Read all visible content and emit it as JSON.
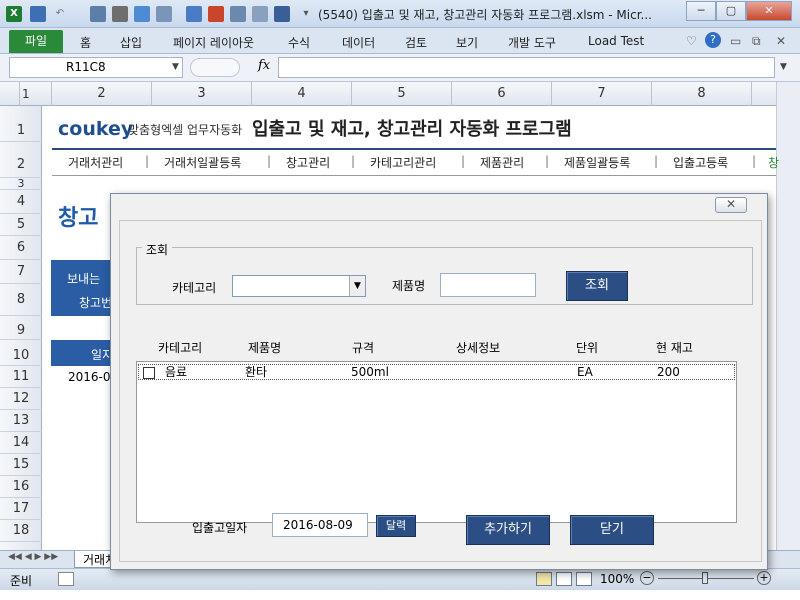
{
  "window": {
    "title": "(5540) 입출고 및 재고, 창고관리 자동화 프로그램.xlsm  -  Micr...",
    "min": "─",
    "max": "▢",
    "close": "✕"
  },
  "ribbon": {
    "file": "파일",
    "tabs": [
      "홈",
      "삽입",
      "페이지 레이아웃",
      "수식",
      "데이터",
      "검토",
      "보기",
      "개발 도구",
      "Load Test"
    ]
  },
  "formula_bar": {
    "name_box": "R11C8",
    "fx": "fx"
  },
  "columns": [
    "1",
    "2",
    "3",
    "4",
    "5",
    "6",
    "7",
    "8"
  ],
  "rows": [
    "1",
    "2",
    "3",
    "4",
    "5",
    "6",
    "7",
    "8",
    "9",
    "10",
    "11",
    "12",
    "13",
    "14",
    "15",
    "16",
    "17",
    "18"
  ],
  "sheet": {
    "brand": "coukey",
    "brand_sub": "맞춤형엑셀 업무자동화",
    "app_title": "입출고 및 재고, 창고관리 자동화 프로그램",
    "menu": [
      "거래처관리",
      "거래처일괄등록",
      "창고관리",
      "카테고리관리",
      "제품관리",
      "제품일괄등록",
      "입출고등록",
      "창"
    ],
    "page_title": "창고",
    "side_label_1": "보내는",
    "side_label_2": "창고번",
    "col_hdr_partial": "일지",
    "date_partial": "2016-0"
  },
  "sheet_tabs": {
    "first": "거래처관리"
  },
  "status": {
    "ready": "준비",
    "zoom": "100%"
  },
  "dialog": {
    "close": "✕",
    "search_legend": "조회",
    "category_label": "카테고리",
    "product_label": "제품명",
    "search_button": "조회",
    "list_headers": [
      "카테고리",
      "제품명",
      "규격",
      "상세정보",
      "단위",
      "현 재고"
    ],
    "items": [
      {
        "category": "음료",
        "product": "환타",
        "spec": "500ml",
        "detail": "",
        "unit": "EA",
        "stock": "200"
      }
    ],
    "date_label": "입출고일자",
    "date_value": "2016-08-09",
    "calendar_button": "달력",
    "add_button": "추가하기",
    "close_button": "닫기"
  }
}
